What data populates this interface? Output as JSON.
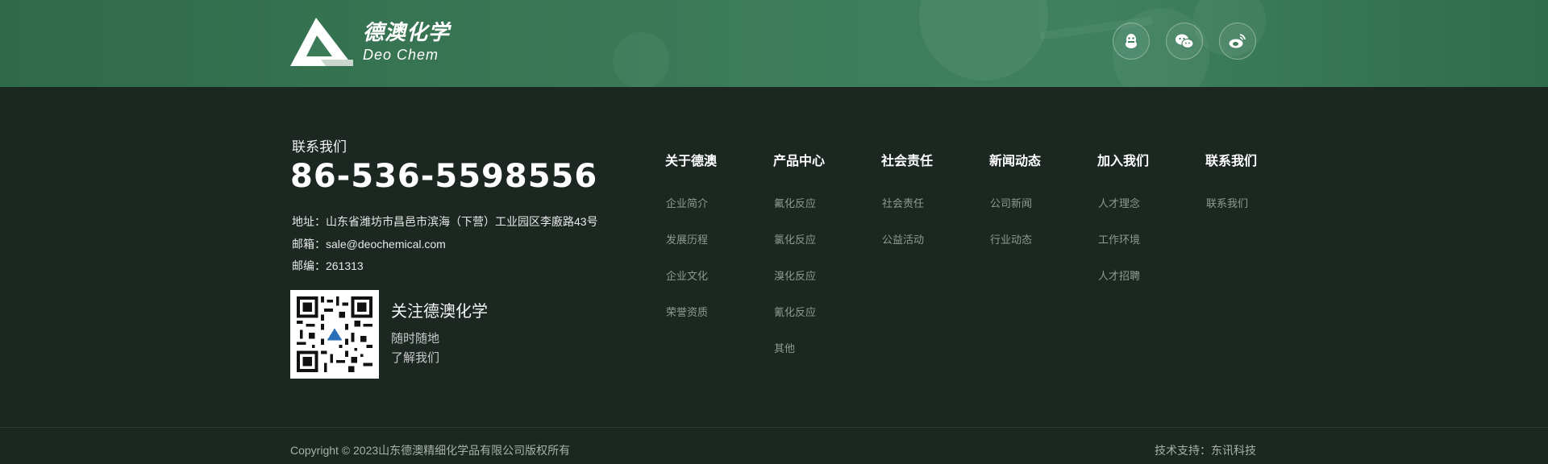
{
  "brand": {
    "name_cn": "德澳化学",
    "name_en": "Deo Chem"
  },
  "social": [
    {
      "icon": "qq-icon",
      "label": "QQ"
    },
    {
      "icon": "wechat-icon",
      "label": "WeChat"
    },
    {
      "icon": "weibo-icon",
      "label": "Weibo"
    }
  ],
  "contact": {
    "title": "联系我们",
    "phone": "86-536-5598556",
    "address": "地址：山东省潍坊市昌邑市滨海（下营）工业园区李廒路43号",
    "email": "邮箱：sale@deochemical.com",
    "zip": "邮编：261313"
  },
  "follow": {
    "title": "关注德澳化学",
    "line1": "随时随地",
    "line2": "了解我们"
  },
  "nav": [
    {
      "heading": "关于德澳",
      "links": [
        "企业简介",
        "发展历程",
        "企业文化",
        "荣誉资质"
      ]
    },
    {
      "heading": "产品中心",
      "links": [
        "氟化反应",
        "氯化反应",
        "溴化反应",
        "氰化反应",
        "其他"
      ]
    },
    {
      "heading": "社会责任",
      "links": [
        "社会责任",
        "公益活动"
      ]
    },
    {
      "heading": "新闻动态",
      "links": [
        "公司新闻",
        "行业动态"
      ]
    },
    {
      "heading": "加入我们",
      "links": [
        "人才理念",
        "工作环境",
        "人才招聘"
      ]
    },
    {
      "heading": "联系我们",
      "links": [
        "联系我们"
      ]
    }
  ],
  "footer": {
    "copyright": "Copyright © 2023山东德澳精细化学品有限公司版权所有",
    "tech": "技术支持：东讯科技"
  },
  "colors": {
    "band": "#3b7b58",
    "background": "#1b2720",
    "muted_link": "#8f9a93"
  }
}
